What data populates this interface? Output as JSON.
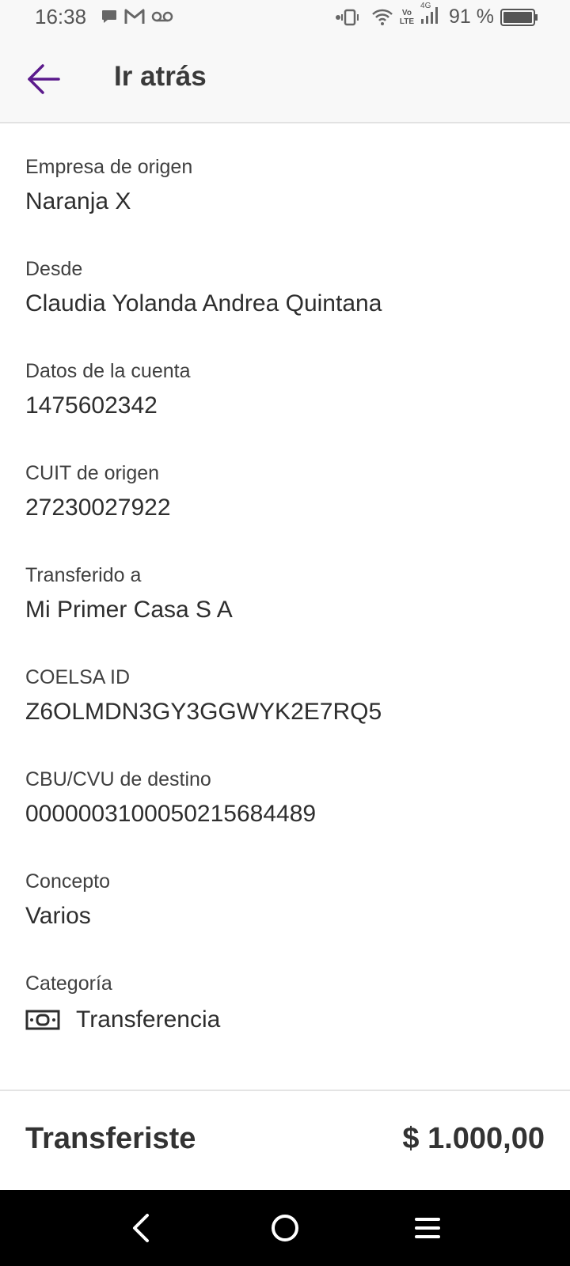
{
  "status_bar": {
    "time": "16:38",
    "battery_percent": "91 %",
    "network_label_top": "Vo",
    "network_label_bottom": "LTE",
    "network_generation": "4G"
  },
  "app_bar": {
    "title": "Ir atrás"
  },
  "fields": [
    {
      "label": "Empresa de origen",
      "value": "Naranja X"
    },
    {
      "label": "Desde",
      "value": "Claudia Yolanda Andrea Quintana"
    },
    {
      "label": "Datos de la cuenta",
      "value": "1475602342"
    },
    {
      "label": "CUIT de origen",
      "value": "27230027922"
    },
    {
      "label": "Transferido a",
      "value": "Mi Primer Casa S A"
    },
    {
      "label": "COELSA ID",
      "value": "Z6OLMDN3GY3GGWYK2E7RQ5"
    },
    {
      "label": "CBU/CVU de destino",
      "value": "0000003100050215684489"
    },
    {
      "label": "Concepto",
      "value": "Varios"
    }
  ],
  "category": {
    "label": "Categoría",
    "value": "Transferencia",
    "icon": "money-bill-icon"
  },
  "summary": {
    "label": "Transferiste",
    "amount": "$ 1.000,00"
  },
  "colors": {
    "accent": "#5b1a8c",
    "app_bar_bg": "#f8f8f8",
    "nav_bar_bg": "#000000"
  }
}
